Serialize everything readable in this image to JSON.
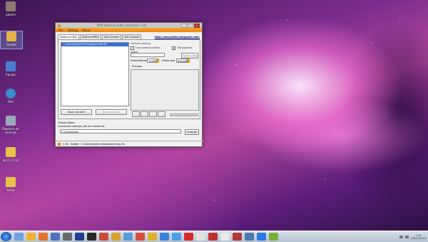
{
  "desktop": {
    "icons": [
      {
        "label": "Jalenni",
        "color": "#8a7a70"
      },
      {
        "label": "Google",
        "color": "#e6b34a"
      },
      {
        "label": "Equipo",
        "color": "#4a7fd0"
      },
      {
        "label": "Red",
        "color": "#3a8ad0"
      },
      {
        "label": "Papelera de reciclaje",
        "color": "#9aa8b8"
      },
      {
        "label": "april / 2 rpt",
        "color": "#e8c24a"
      },
      {
        "label": "temp",
        "color": "#e8c24a"
      }
    ]
  },
  "window": {
    "title": "PRO Video & Audio Converter 1.30",
    "menu": [
      "File",
      "Setting",
      "About"
    ],
    "tabs": [
      "Video to DVD",
      "DVD to MPEG",
      "AVI Convert",
      "AVI Convert"
    ],
    "link": "http://easyvideo.blogspot.com/",
    "list": {
      "selected": "C:\\Users\\Admin\\Desktop\\Comp.flv"
    },
    "convert_setting_label": "Convert setting",
    "opt_identical": "Use indentical files",
    "opt_transparent": "Transparent video",
    "audio_file_label": "Audio file",
    "select_file_button": "Select file",
    "video_bitrate_label": "Video Bitrate",
    "video_bitrate_value": "1500k",
    "video_size_label": "Video size",
    "video_size_value": "640x480",
    "preview_label": "Preview",
    "start_button": "Start convert",
    "stop_button": "Stop convert",
    "output_label": "Output folder",
    "output_note": "Converted video(s) will be moved to:",
    "output_path": "C:\\Converted",
    "change_button": "Change",
    "status_version": "1.30",
    "status_text": "Added : C:\\Users\\Admin\\Desktop\\Comp.flv"
  },
  "taskbar": {
    "apps": [
      "#6fa3e0",
      "#f0b232",
      "#e2742b",
      "#5070c0",
      "#6a6a6a",
      "#1e3c8a",
      "#2a2a2a",
      "#cc4a3a",
      "#d8a22a",
      "#5a9ad8",
      "#d84a3a",
      "#e0b02a",
      "#3a82d8",
      "#4aa0e0",
      "#d82a2a",
      "#e0e0e0",
      "#c03030",
      "#e8e8e8",
      "#b03a3a",
      "#4a7ab0",
      "#2a7ae0",
      "#7ab03a"
    ],
    "clock_time": "1:50",
    "clock_date": "09/12/2013"
  }
}
